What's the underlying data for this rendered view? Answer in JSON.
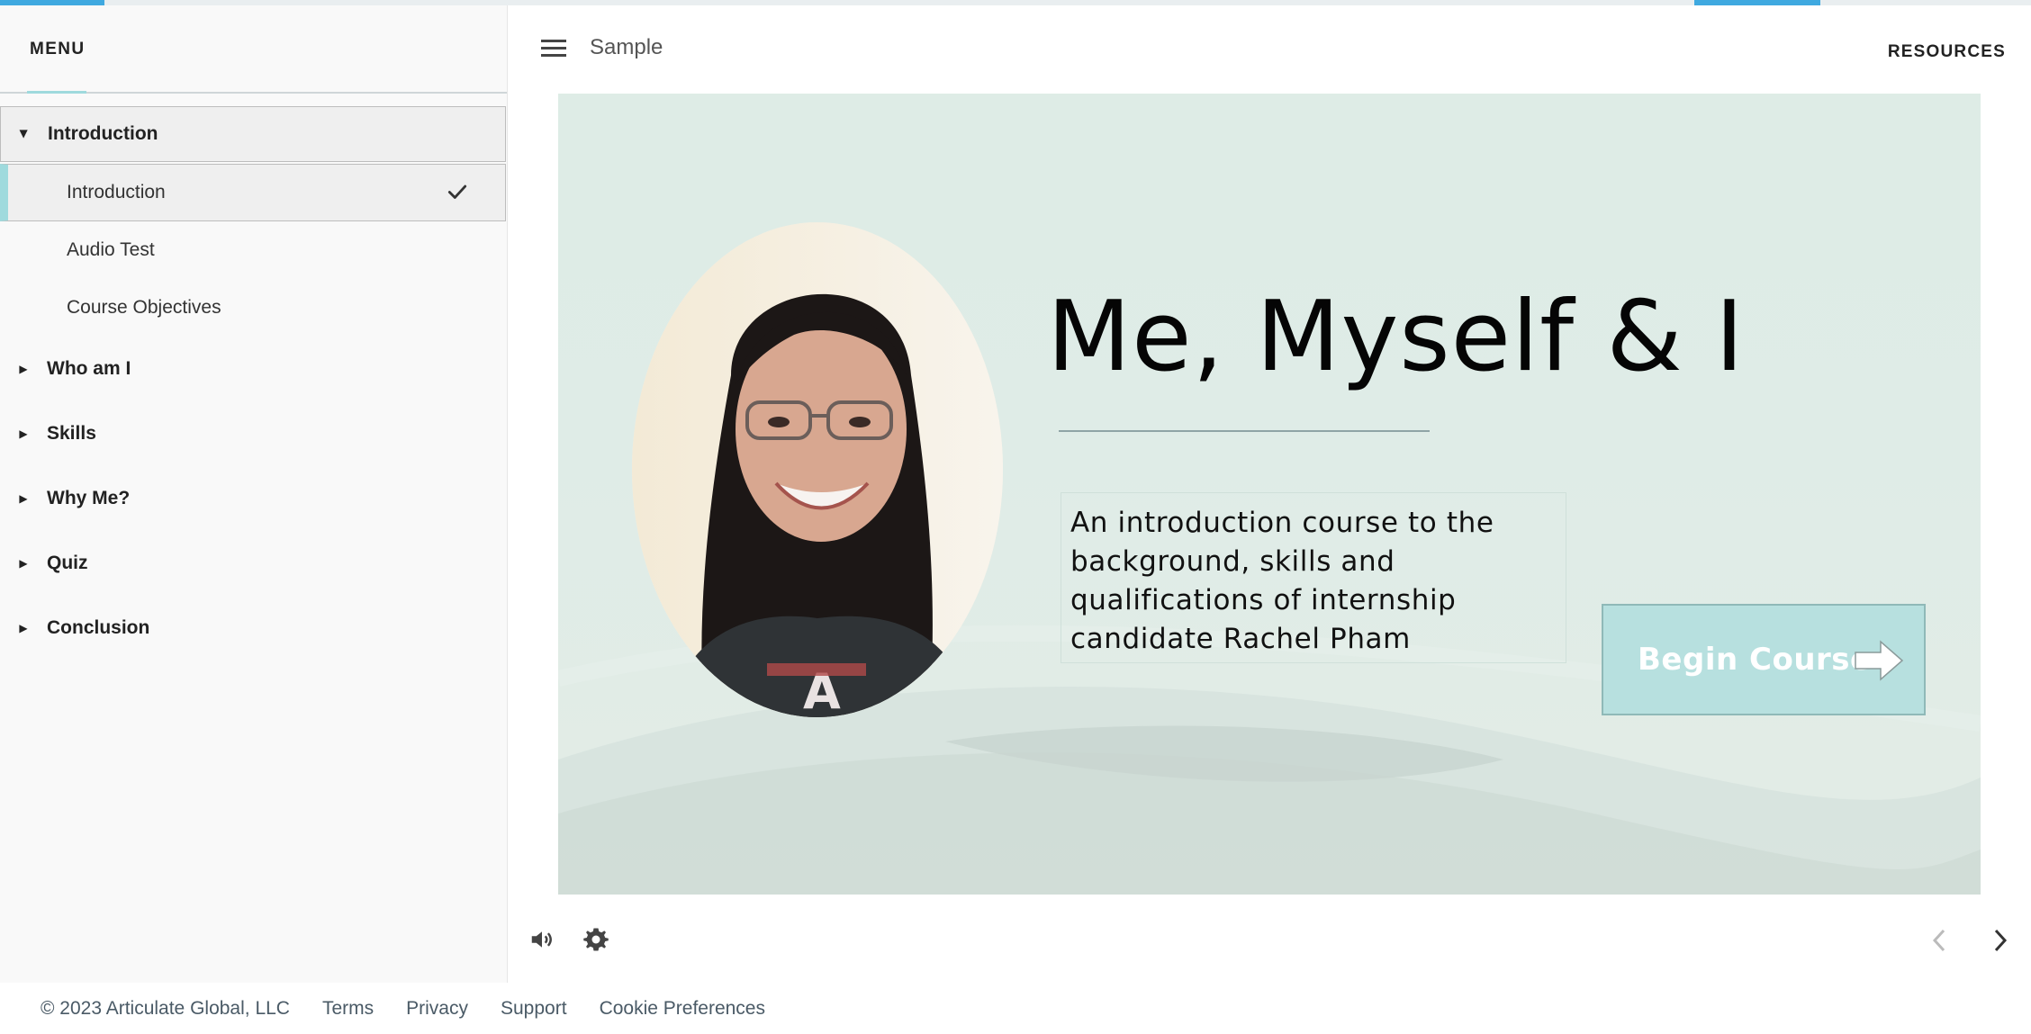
{
  "sidebar": {
    "menu_title": "MENU",
    "sections": [
      {
        "label": "Introduction",
        "expanded": true,
        "lessons": [
          {
            "label": "Introduction",
            "active": true,
            "completed": true
          },
          {
            "label": "Audio Test"
          },
          {
            "label": "Course Objectives"
          }
        ]
      },
      {
        "label": "Who am I",
        "expanded": false
      },
      {
        "label": "Skills",
        "expanded": false
      },
      {
        "label": "Why Me?",
        "expanded": false
      },
      {
        "label": "Quiz",
        "expanded": false
      },
      {
        "label": "Conclusion",
        "expanded": false
      }
    ]
  },
  "header": {
    "course_title": "Sample",
    "resources_label": "RESOURCES",
    "menu_icon": "hamburger-icon"
  },
  "slide": {
    "title": "Me, Myself & I",
    "description": "An introduction course to the background, skills and qualifications of internship candidate Rachel Pham",
    "description_lines": [
      "An introduction course to the",
      "background, skills and",
      "qualifications of internship",
      "candidate Rachel Pham"
    ],
    "begin_button_label": "Begin Course",
    "begin_button_icon": "arrow-right-icon"
  },
  "controls": {
    "volume_icon": "volume-icon",
    "settings_icon": "gear-icon",
    "prev_icon": "chevron-left-icon",
    "next_icon": "chevron-right-icon"
  },
  "footer": {
    "copyright": "© 2023 Articulate Global, LLC",
    "links": [
      "Terms",
      "Privacy",
      "Support",
      "Cookie Preferences"
    ]
  },
  "colors": {
    "accent": "#9fdadd",
    "progress": "#3fa9e0",
    "slide_bg": "#deece6",
    "button_bg": "#b7e0df"
  }
}
